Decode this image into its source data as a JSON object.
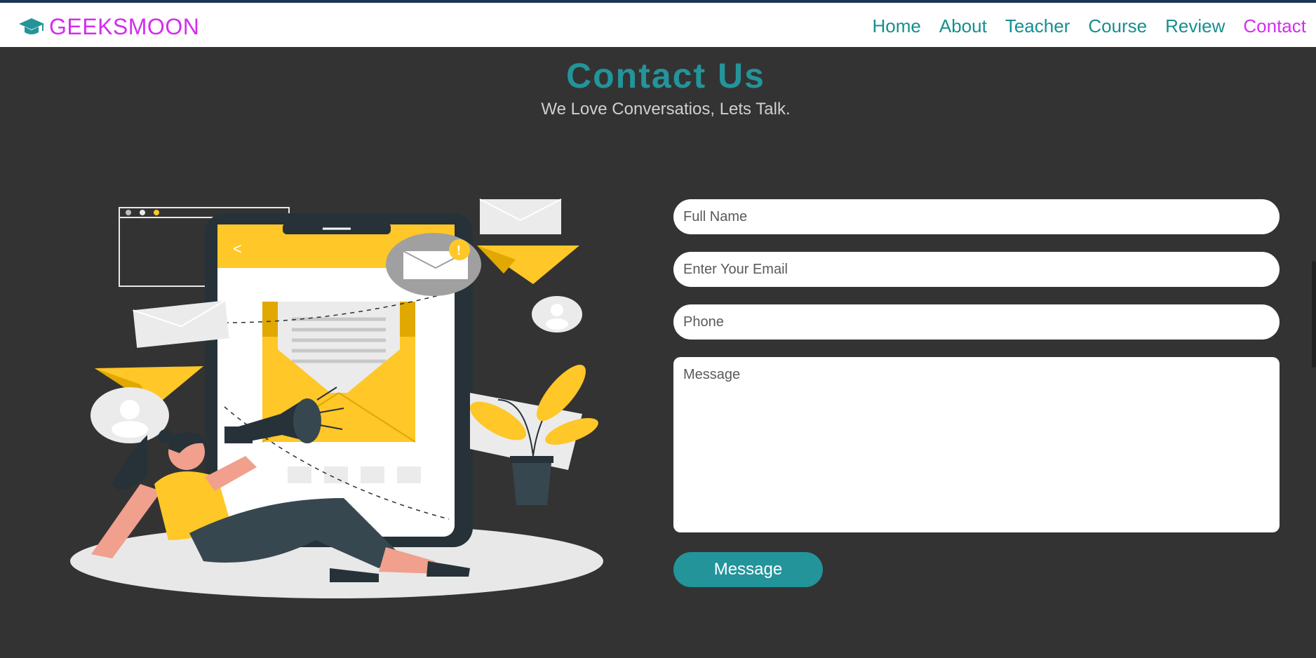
{
  "brand": {
    "name": "GEEKSMOON",
    "icon": "graduation-cap-icon"
  },
  "nav": {
    "items": [
      {
        "label": "Home",
        "active": false
      },
      {
        "label": "About",
        "active": false
      },
      {
        "label": "Teacher",
        "active": false
      },
      {
        "label": "Course",
        "active": false
      },
      {
        "label": "Review",
        "active": false
      },
      {
        "label": "Contact",
        "active": true
      }
    ]
  },
  "contact": {
    "title": "Contact Us",
    "subtitle": "We Love Conversatios, Lets Talk."
  },
  "form": {
    "name_placeholder": "Full Name",
    "email_placeholder": "Enter Your Email",
    "phone_placeholder": "Phone",
    "message_placeholder": "Message",
    "submit_label": "Message"
  },
  "colors": {
    "accent": "#23949a",
    "brand": "#d42cf0",
    "background": "#333333",
    "illustration_yellow": "#ffc727"
  }
}
